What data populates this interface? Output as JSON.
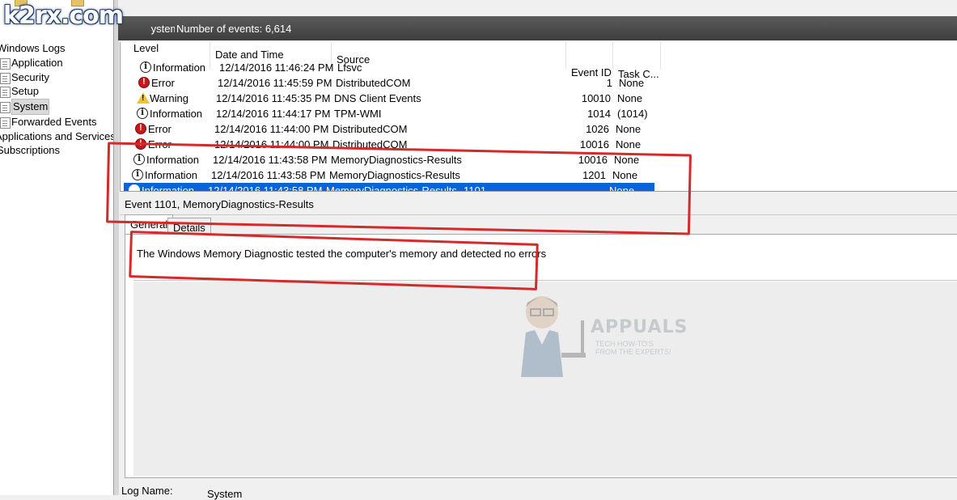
{
  "watermark": {
    "text": "k2rx.com"
  },
  "tree": {
    "windows_logs": "Windows Logs",
    "items": [
      {
        "label": "Application"
      },
      {
        "label": "Security"
      },
      {
        "label": "Setup"
      },
      {
        "label": "System",
        "selected": true
      },
      {
        "label": "Forwarded Events"
      }
    ],
    "applications_and_services": "Applications and Services Lo",
    "subscriptions": "Subscriptions"
  },
  "header": {
    "log_name": "System",
    "events_count": "Number of events: 6,614"
  },
  "grid": {
    "columns": [
      "Level",
      "Date and Time",
      "Source",
      "Event ID",
      "Task C..."
    ],
    "rows": [
      {
        "level": "Information",
        "icon": "info-icon",
        "datetime": "12/14/2016 11:46:24 PM",
        "source": "Lfsvc",
        "event_id": "",
        "task": ""
      },
      {
        "level": "Error",
        "icon": "error-icon",
        "datetime": "12/14/2016 11:45:59 PM",
        "source": "DistributedCOM",
        "event_id": "1",
        "task": "None"
      },
      {
        "level": "Warning",
        "icon": "warning-icon",
        "datetime": "12/14/2016 11:45:35 PM",
        "source": "DNS Client Events",
        "event_id": "10010",
        "task": "None"
      },
      {
        "level": "Information",
        "icon": "info-icon",
        "datetime": "12/14/2016 11:44:17 PM",
        "source": "TPM-WMI",
        "event_id": "1014",
        "task": "(1014)"
      },
      {
        "level": "Error",
        "icon": "error-icon",
        "datetime": "12/14/2016 11:44:00 PM",
        "source": "DistributedCOM",
        "event_id": "1026",
        "task": "None"
      },
      {
        "level": "Error",
        "icon": "error-icon",
        "datetime": "12/14/2016 11:44:00 PM",
        "source": "DistributedCOM",
        "event_id": "10016",
        "task": "None"
      },
      {
        "level": "Information",
        "icon": "info-icon",
        "datetime": "12/14/2016 11:43:58 PM",
        "source": "MemoryDiagnostics-Results",
        "event_id": "10016",
        "task": "None"
      },
      {
        "level": "Information",
        "icon": "info-icon",
        "datetime": "12/14/2016 11:43:58 PM",
        "source": "MemoryDiagnostics-Results",
        "event_id": "1201",
        "task": "None"
      },
      {
        "level": "Information",
        "icon": "info-icon",
        "datetime": "12/14/2016 11:43:58 PM",
        "source": "MemoryDiagnostics-Results",
        "event_id": "1101",
        "task": "None",
        "selected": true
      }
    ]
  },
  "details": {
    "title": "Event 1101, MemoryDiagnostics-Results",
    "tabs": [
      "General",
      "Details"
    ],
    "description": "The Windows Memory Diagnostic tested the computer's memory and detected no errors",
    "log_name_label": "Log Name:",
    "log_name_value": "System"
  },
  "appuals": {
    "name": "APPUALS",
    "tagline": "TECH HOW-TO'S FROM THE EXPERTS!"
  },
  "colors": {
    "selection": "#0a64d8",
    "annotation": "#d42a2a",
    "header_bg": "#4a4a4a"
  }
}
